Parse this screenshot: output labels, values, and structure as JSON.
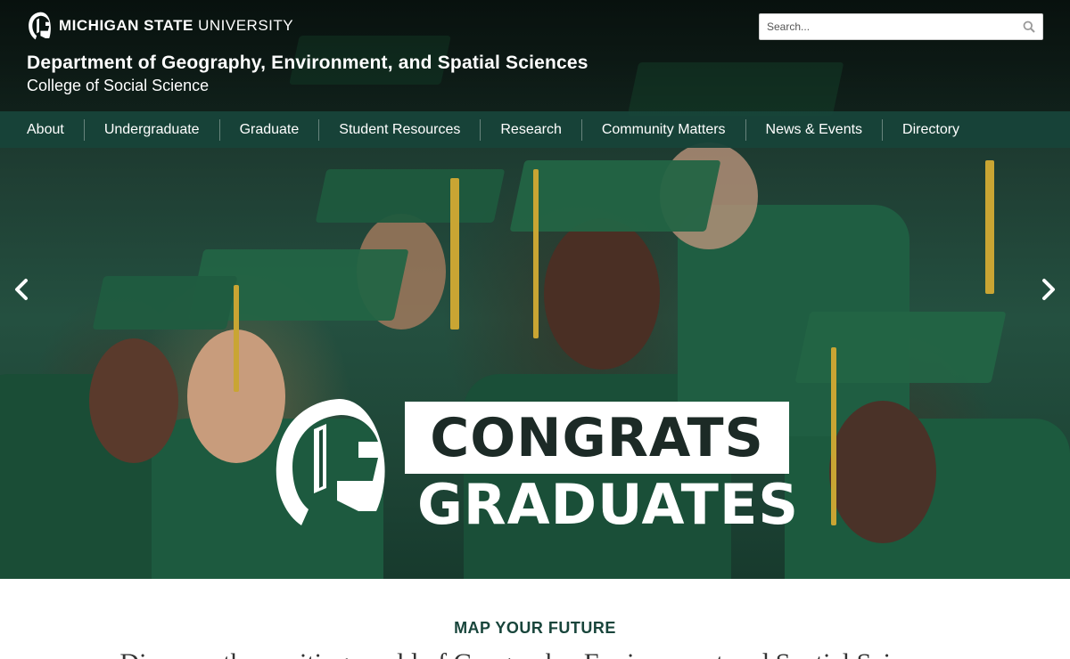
{
  "header": {
    "university_wordmark_bold": "MICHIGAN STATE",
    "university_wordmark_light": " UNIVERSITY",
    "department_title": "Department of Geography, Environment, and Spatial Sciences",
    "college_name": "College of Social Science"
  },
  "search": {
    "placeholder": "Search...",
    "value": "",
    "icon": "search-icon"
  },
  "nav": {
    "items": [
      {
        "label": "About"
      },
      {
        "label": "Undergraduate"
      },
      {
        "label": "Graduate"
      },
      {
        "label": "Student Resources"
      },
      {
        "label": "Research"
      },
      {
        "label": "Community Matters"
      },
      {
        "label": "News & Events"
      },
      {
        "label": "Directory"
      }
    ]
  },
  "hero": {
    "congrats_word": "CONGRATS",
    "graduates_word": "GRADUATES",
    "prev_icon": "chevron-left-icon",
    "next_icon": "chevron-right-icon"
  },
  "intro_section": {
    "eyebrow": "MAP YOUR FUTURE",
    "headline": "Discover the exciting world of Geography, Environment and Spatial Sciences"
  },
  "colors": {
    "msu_green": "#18453b",
    "nav_bg": "#18453b",
    "accent_gold": "#c9a533"
  }
}
